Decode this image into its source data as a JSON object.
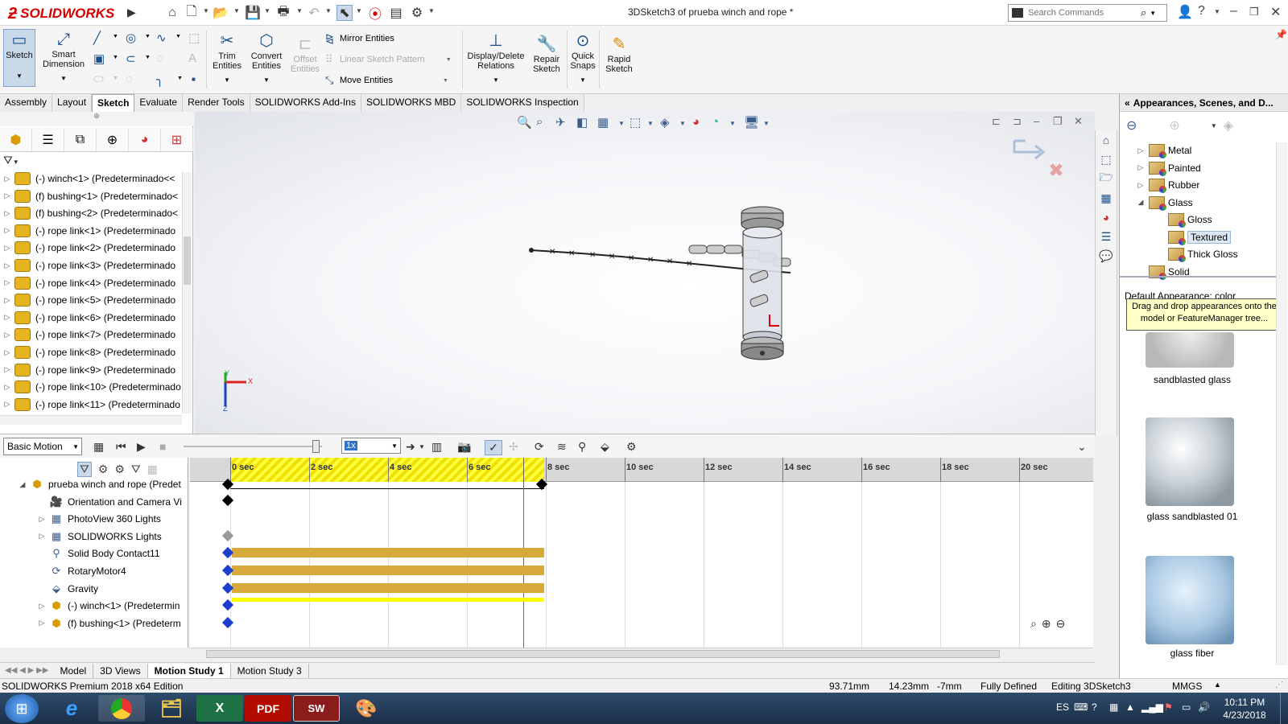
{
  "app": {
    "logo_text": "SOLIDWORKS",
    "document_title": "3DSketch3 of prueba winch and rope *",
    "search_placeholder": "Search Commands"
  },
  "ribbon": {
    "sketch": "Sketch",
    "smart_dimension_1": "Smart",
    "smart_dimension_2": "Dimension",
    "trim_1": "Trim",
    "trim_2": "Entities",
    "convert_1": "Convert",
    "convert_2": "Entities",
    "offset_1": "Offset",
    "offset_2": "Entities",
    "mirror": "Mirror Entities",
    "linear_pattern": "Linear Sketch Pattern",
    "move": "Move Entities",
    "display_relations_1": "Display/Delete",
    "display_relations_2": "Relations",
    "repair_1": "Repair",
    "repair_2": "Sketch",
    "quick_snaps_1": "Quick",
    "quick_snaps_2": "Snaps",
    "rapid_1": "Rapid",
    "rapid_2": "Sketch"
  },
  "command_tabs": [
    "Assembly",
    "Layout",
    "Sketch",
    "Evaluate",
    "Render Tools",
    "SOLIDWORKS Add-Ins",
    "SOLIDWORKS MBD",
    "SOLIDWORKS Inspection"
  ],
  "feature_tree": [
    "(-) winch<1> (Predeterminado<<",
    "(f) bushing<1> (Predeterminado<",
    "(f) bushing<2> (Predeterminado<",
    "(-) rope link<1> (Predeterminado",
    "(-) rope link<2> (Predeterminado",
    "(-) rope link<3> (Predeterminado",
    "(-) rope link<4> (Predeterminado",
    "(-) rope link<5> (Predeterminado",
    "(-) rope link<6> (Predeterminado",
    "(-) rope link<7> (Predeterminado",
    "(-) rope link<8> (Predeterminado",
    "(-) rope link<9> (Predeterminado",
    "(-) rope link<10> (Predeterminado",
    "(-) rope link<11> (Predeterminado"
  ],
  "triad": {
    "x": "X",
    "y": "Y",
    "z": "Z"
  },
  "appearances": {
    "title": "Appearances, Scenes, and D...",
    "tree": [
      {
        "label": "Metal",
        "expander": "▷"
      },
      {
        "label": "Painted",
        "expander": "▷"
      },
      {
        "label": "Rubber",
        "expander": "▷"
      },
      {
        "label": "Glass",
        "expander": "◢"
      },
      {
        "label": "Gloss",
        "expander": ""
      },
      {
        "label": "Textured",
        "expander": "",
        "selected": true
      },
      {
        "label": "Thick Gloss",
        "expander": ""
      },
      {
        "label": "Solid",
        "expander": ""
      }
    ],
    "default_label": "Default Appearance: color",
    "tooltip": "Drag and drop appearances onto the model or FeatureManager tree...",
    "swatches": [
      "sandblasted glass",
      "glass sandblasted 01",
      "glass fiber"
    ]
  },
  "motion": {
    "study_type": "Basic Motion",
    "playback_speed": "1x",
    "ruler": [
      "0 sec",
      "2 sec",
      "4 sec",
      "6 sec",
      "8 sec",
      "10 sec",
      "12 sec",
      "14 sec",
      "16 sec",
      "18 sec",
      "20 sec"
    ],
    "tree": [
      {
        "label": "prueba winch and rope  (Predet",
        "expander": "◢",
        "icon": "assembly-icon"
      },
      {
        "label": "Orientation and Camera Vi",
        "expander": "",
        "icon": "camera-icon"
      },
      {
        "label": "PhotoView 360 Lights",
        "expander": "▷",
        "icon": "lights-icon"
      },
      {
        "label": "SOLIDWORKS Lights",
        "expander": "▷",
        "icon": "lights-icon"
      },
      {
        "label": "Solid Body Contact11",
        "expander": "",
        "icon": "contact-icon"
      },
      {
        "label": "RotaryMotor4",
        "expander": "",
        "icon": "motor-icon"
      },
      {
        "label": "Gravity",
        "expander": "",
        "icon": "gravity-icon"
      },
      {
        "label": "(-) winch<1> (Predetermin",
        "expander": "▷",
        "icon": "part-icon"
      },
      {
        "label": "(f) bushing<1> (Predeterm",
        "expander": "▷",
        "icon": "part-icon"
      }
    ]
  },
  "bottom_tabs": [
    "Model",
    "3D Views",
    "Motion Study 1",
    "Motion Study 3"
  ],
  "status": {
    "edition": "SOLIDWORKS Premium 2018 x64 Edition",
    "x": "93.71mm",
    "y": "14.23mm",
    "z": "-7mm",
    "defined": "Fully Defined",
    "editing": "Editing 3DSketch3",
    "units": "MMGS"
  },
  "taskbar": {
    "language": "ES",
    "time": "10:11 PM",
    "date": "4/23/2018"
  }
}
